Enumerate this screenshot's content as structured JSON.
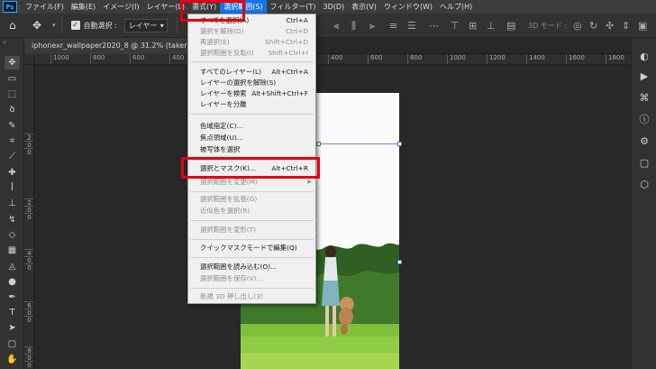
{
  "menubar": {
    "logo": "Ps",
    "items": [
      {
        "label": "ファイル(F)"
      },
      {
        "label": "編集(E)"
      },
      {
        "label": "イメージ(I)"
      },
      {
        "label": "レイヤー(L)"
      },
      {
        "label": "書式(Y)"
      },
      {
        "label": "選択範囲(S)"
      },
      {
        "label": "フィルター(T)"
      },
      {
        "label": "3D(D)"
      },
      {
        "label": "表示(V)"
      },
      {
        "label": "ウィンドウ(W)"
      },
      {
        "label": "ヘルプ(H)"
      }
    ]
  },
  "options": {
    "auto_select_label": "自動選択 :",
    "auto_select_value": "レイヤー",
    "mode_3d_label": "3D モード :",
    "checkmark": "✓"
  },
  "document": {
    "tab_title": "iphonexr_wallpaper2020_8 @ 31.2% (takerukum"
  },
  "ruler": {
    "h_ticks": [
      "1000",
      "800",
      "600",
      "400",
      "200",
      "0",
      "200",
      "400",
      "600",
      "800",
      "1000",
      "1200",
      "1400",
      "1600",
      "1800"
    ],
    "v_ticks": [
      "2",
      "0",
      "0",
      "2",
      "0",
      "0",
      "4",
      "0",
      "0",
      "6",
      "0",
      "0",
      "8",
      "0",
      "0"
    ]
  },
  "select_menu": {
    "items": [
      {
        "label": "すべてを選択(A)",
        "shortcut": "Ctrl+A",
        "enabled": true
      },
      {
        "label": "選択を解除(D)",
        "shortcut": "Ctrl+D",
        "enabled": false
      },
      {
        "label": "再選択(E)",
        "shortcut": "Shift+Ctrl+D",
        "enabled": false
      },
      {
        "label": "選択範囲を反転(I)",
        "shortcut": "Shift+Ctrl+I",
        "enabled": false
      },
      {
        "label": "すべてのレイヤー(L)",
        "shortcut": "Alt+Ctrl+A",
        "enabled": true
      },
      {
        "label": "レイヤーの選択を解除(S)",
        "shortcut": "",
        "enabled": true
      },
      {
        "label": "レイヤーを検索",
        "shortcut": "Alt+Shift+Ctrl+F",
        "enabled": true
      },
      {
        "label": "レイヤーを分離",
        "shortcut": "",
        "enabled": true
      },
      {
        "label": "色域指定(C)...",
        "shortcut": "",
        "enabled": true
      },
      {
        "label": "焦点領域(U)...",
        "shortcut": "",
        "enabled": true
      },
      {
        "label": "被写体を選択",
        "shortcut": "",
        "enabled": true
      },
      {
        "label": "選択とマスク(K)...",
        "shortcut": "Alt+Ctrl+R",
        "enabled": true
      },
      {
        "label": "選択範囲を変更(M)",
        "shortcut": "",
        "enabled": false
      },
      {
        "label": "選択範囲を拡張(G)",
        "shortcut": "",
        "enabled": false
      },
      {
        "label": "近似色を選択(R)",
        "shortcut": "",
        "enabled": false
      },
      {
        "label": "選択範囲を変形(T)",
        "shortcut": "",
        "enabled": false
      },
      {
        "label": "クイックマスクモードで編集(Q)",
        "shortcut": "",
        "enabled": true
      },
      {
        "label": "選択範囲を読み込む(O)...",
        "shortcut": "",
        "enabled": true
      },
      {
        "label": "選択範囲を保存(V)...",
        "shortcut": "",
        "enabled": false
      },
      {
        "label": "新規 3D 押し出し(3)",
        "shortcut": "",
        "enabled": false
      }
    ],
    "submenu_arrow": "▶"
  },
  "colors": {
    "highlight": "#e60012",
    "menu_active": "#1473e6",
    "app_blue": "#31a8ff"
  }
}
